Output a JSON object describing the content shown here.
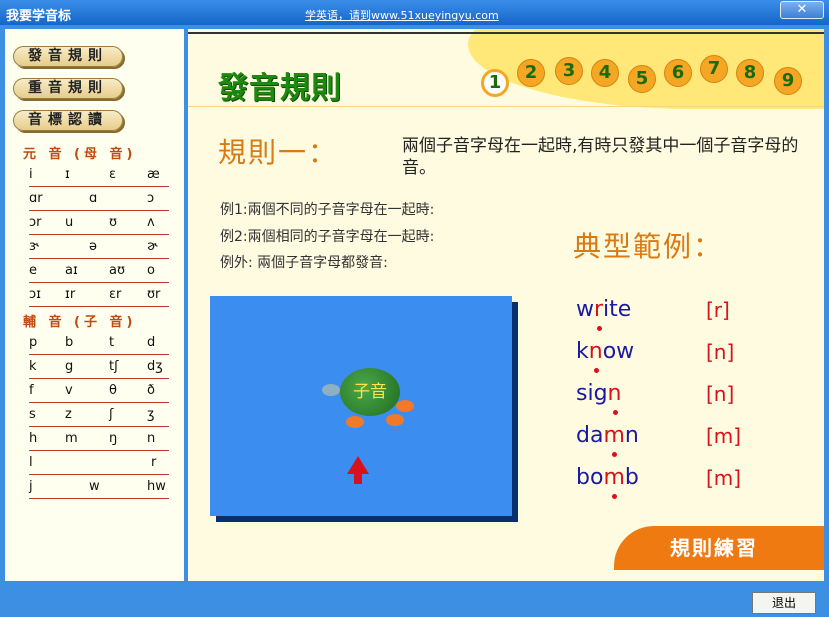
{
  "window": {
    "title": "我要学音标",
    "site_link": "学英语，请到www.51xueyingyu.com",
    "close_glyph": "✕"
  },
  "sidebar": {
    "nav": [
      "發音規則",
      "重音規則",
      "音標認讀"
    ],
    "vowel_head": "元 音 (母 音)",
    "consonant_head": "輔 音 (子 音)",
    "vowel_rows": [
      [
        "i",
        "ɪ",
        "ε",
        "æ"
      ],
      [
        "ɑr",
        "ɑ",
        "ɔ"
      ],
      [
        "ɔr",
        "u",
        "ʊ",
        "ʌ"
      ],
      [
        "ɝ",
        "ə",
        "ɚ"
      ],
      [
        "e",
        "aɪ",
        "aʊ",
        "o"
      ],
      [
        "ɔɪ",
        "ɪr",
        "εr",
        "ʊr"
      ]
    ],
    "consonant_rows": [
      [
        "p",
        "b",
        "t",
        "d"
      ],
      [
        "k",
        "g",
        "tʃ",
        "dʒ"
      ],
      [
        "f",
        "v",
        "θ",
        "ð"
      ],
      [
        "s",
        "z",
        "ʃ",
        "ʒ"
      ],
      [
        "h",
        "m",
        "ŋ",
        "n"
      ],
      [
        "l",
        "r"
      ],
      [
        "j",
        "w",
        "hw"
      ]
    ]
  },
  "main": {
    "title": "發音規則",
    "numbers": [
      "1",
      "2",
      "3",
      "4",
      "5",
      "6",
      "7",
      "8",
      "9"
    ],
    "active_number": "1",
    "rule_title": "規則一：",
    "rule_text": "兩個子音字母在一起時,有時只發其中一個子音字母的音。",
    "examples": [
      "例1:兩個不同的子音字母在一起時:",
      "例2:兩個相同的子音字母在一起時:",
      "例外: 兩個子音字母都發音:"
    ],
    "typical_title": "典型範例：",
    "words": [
      {
        "pre": "w",
        "hl": "r",
        "post": "ite",
        "phon": "[r]"
      },
      {
        "pre": "k",
        "hl": "n",
        "post": "ow",
        "phon": "[n]"
      },
      {
        "pre": "sig",
        "hl": "n",
        "post": "",
        "phon": "[n]"
      },
      {
        "pre": "da",
        "hl": "m",
        "post": "n",
        "phon": "[m]"
      },
      {
        "pre": "bo",
        "hl": "m",
        "post": "b",
        "phon": "[m]"
      }
    ],
    "turtle_label": "子音",
    "practice_label": "規則練習"
  },
  "footer": {
    "exit_label": "退出"
  },
  "colors": {
    "accent_orange": "#f5a623",
    "title_green": "#1d8a0e",
    "highlight_red": "#d8121a",
    "word_blue": "#1a1aa0"
  }
}
